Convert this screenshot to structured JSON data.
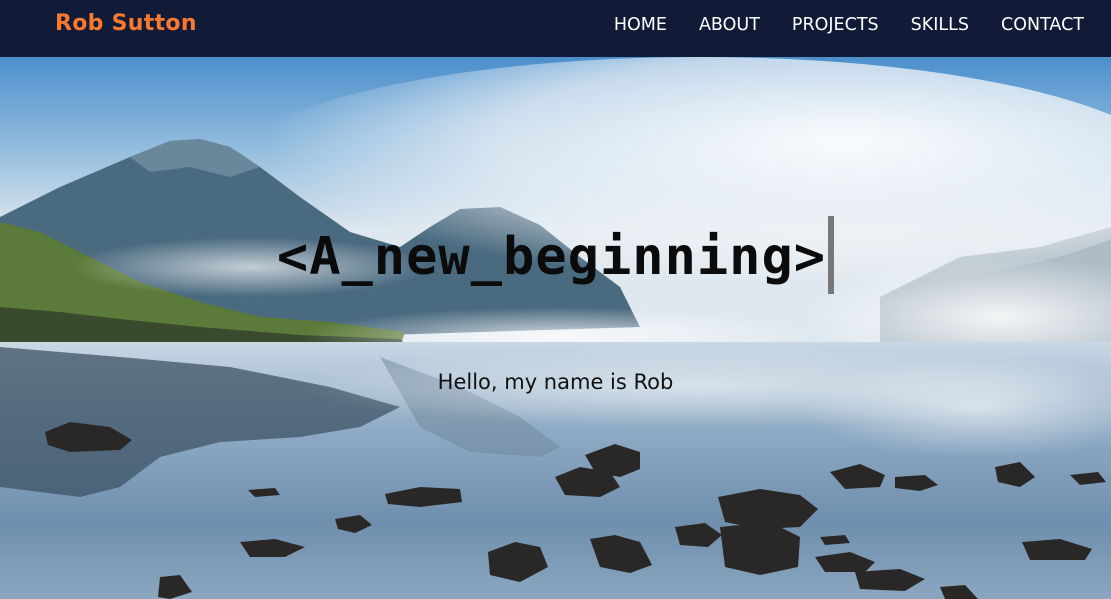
{
  "brand": "Rob Sutton",
  "nav": [
    "HOME",
    "ABOUT",
    "PROJECTS",
    "SKILLS",
    "CONTACT"
  ],
  "hero": {
    "headline": "<A_new_beginning>",
    "subtitle": "Hello, my name is Rob"
  },
  "colors": {
    "navbar": "#111b38",
    "brand": "#f97a2f",
    "nav_text": "#ffffff"
  }
}
